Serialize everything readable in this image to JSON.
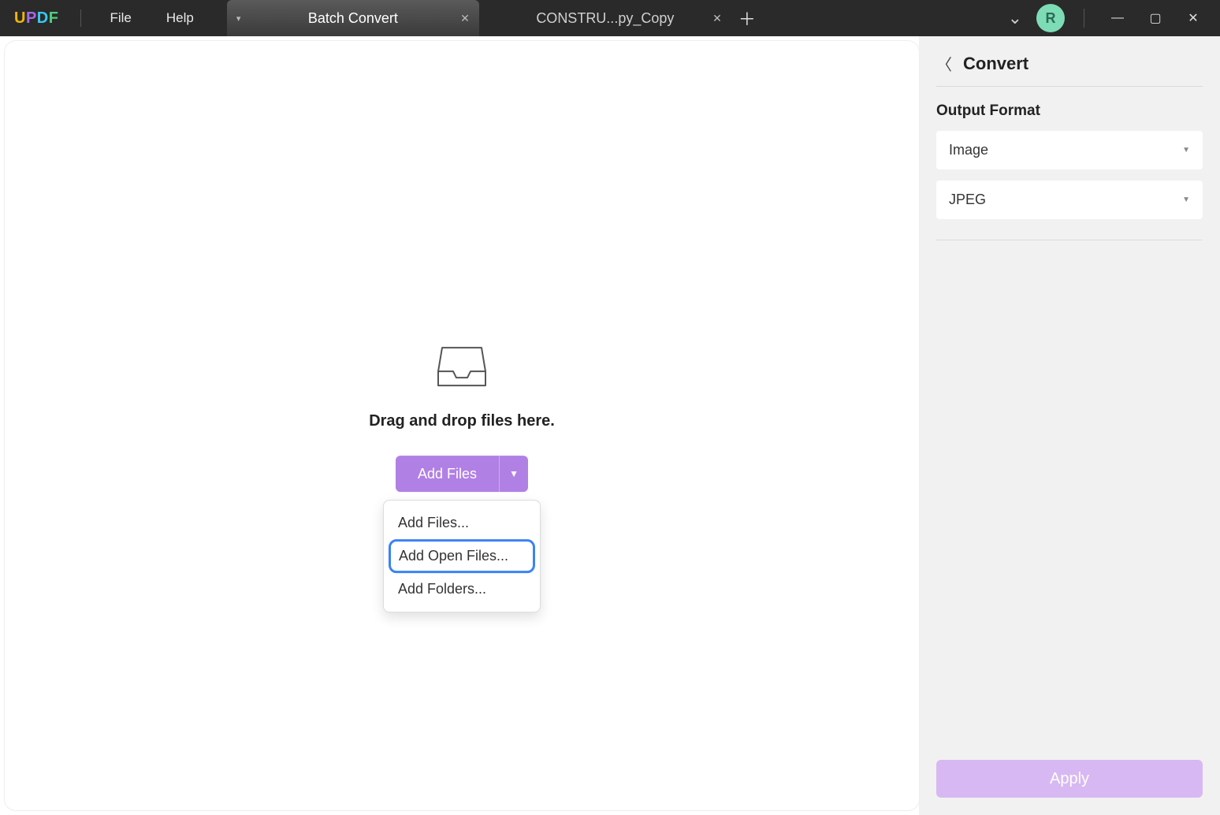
{
  "app": {
    "logo_letters": [
      "U",
      "P",
      "D",
      "F"
    ],
    "avatar_initial": "R"
  },
  "menubar": {
    "file": "File",
    "help": "Help"
  },
  "tabs": {
    "items": [
      {
        "label": "Batch Convert",
        "active": true
      },
      {
        "label": "CONSTRU...py_Copy",
        "active": false
      }
    ]
  },
  "drop": {
    "text": "Drag and drop files here.",
    "add_files_label": "Add Files",
    "menu": {
      "add_files": "Add Files...",
      "add_open_files": "Add Open Files...",
      "add_folders": "Add Folders..."
    }
  },
  "panel": {
    "title": "Convert",
    "output_format_label": "Output Format",
    "format_select": "Image",
    "subformat_select": "JPEG",
    "apply_label": "Apply"
  }
}
